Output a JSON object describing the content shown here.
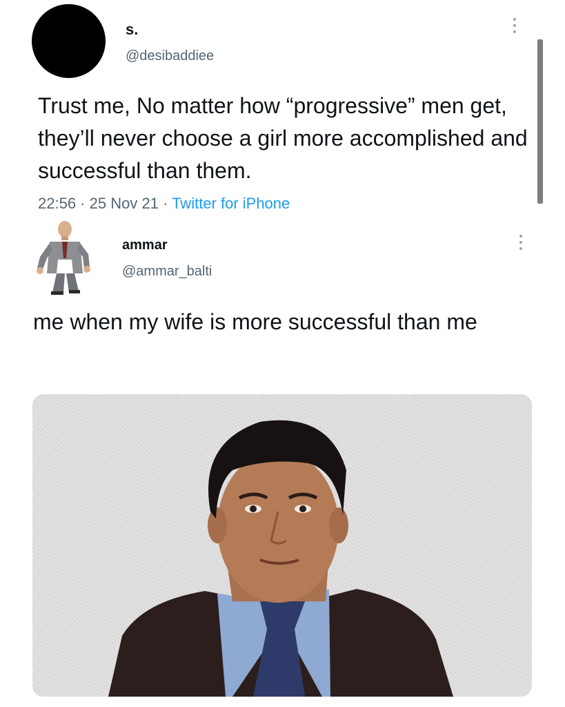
{
  "tweet1": {
    "display_name": "s.",
    "handle": "@desibaddiee",
    "text": "Trust me, No matter how “progressive” men get, they’ll never choose a girl more accomplished and successful than them.",
    "time": "22:56",
    "date": "25 Nov 21",
    "source": "Twitter for iPhone",
    "separator": " · "
  },
  "tweet2": {
    "display_name": "ammar",
    "handle": "@ammar_balti",
    "text": "me when my wife is more successful than me"
  },
  "icons": {
    "more": "more-vertical-icon",
    "avatar1": "avatar-redacted",
    "avatar2": "avatar-game-character"
  },
  "colors": {
    "text": "#0f1419",
    "secondary": "#536471",
    "link": "#1d9bf0",
    "background": "#ffffff"
  }
}
